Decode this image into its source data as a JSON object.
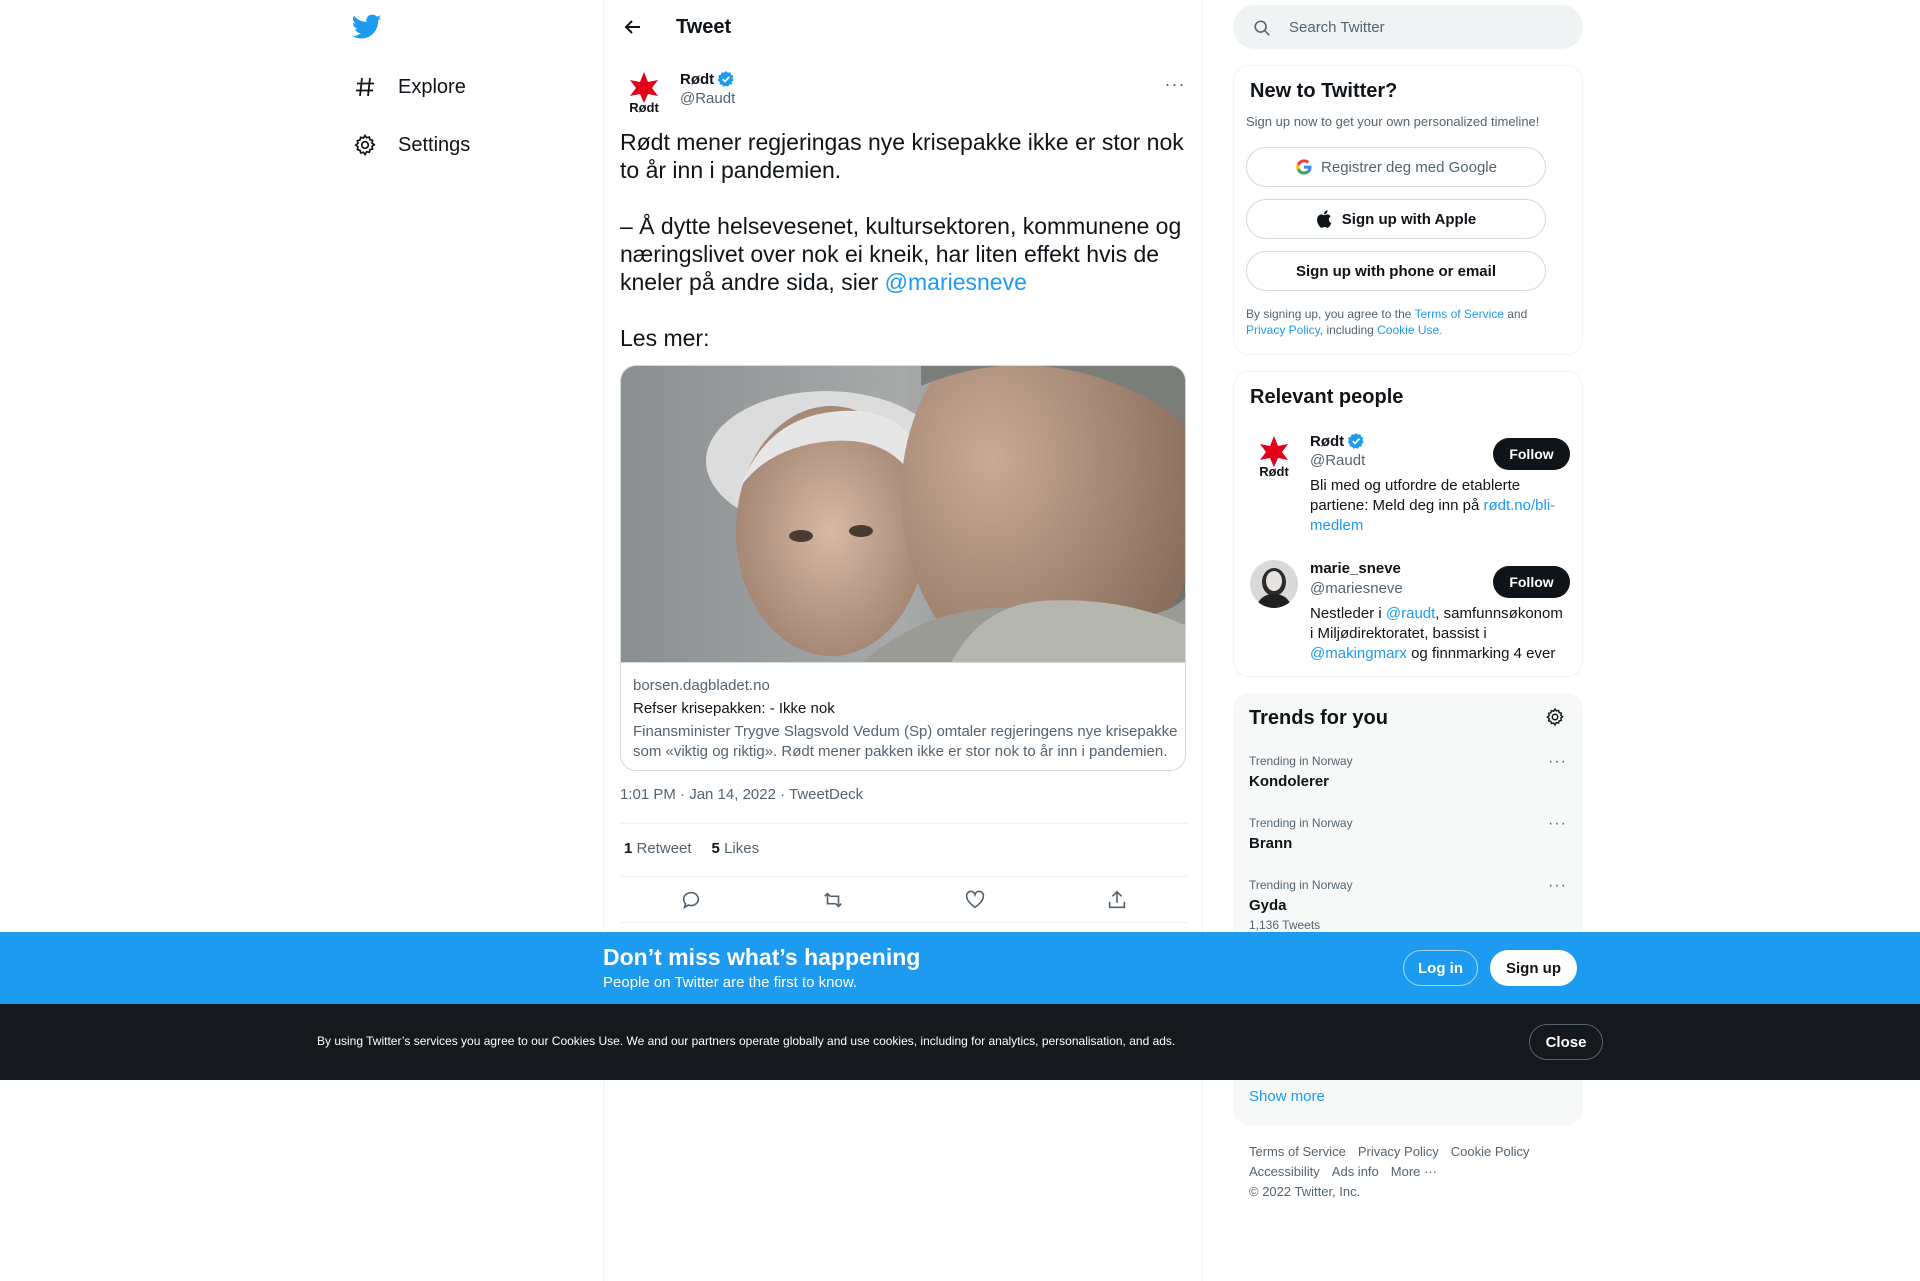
{
  "nav": {
    "items": [
      {
        "label": "Explore",
        "icon": "hashtag-icon"
      },
      {
        "label": "Settings",
        "icon": "gear-icon"
      }
    ]
  },
  "header": {
    "title": "Tweet"
  },
  "tweet": {
    "author_name": "Rødt",
    "author_handle": "@Raudt",
    "avatar_text": "Rødt",
    "text_part1": "Rødt mener regjeringas nye krisepakke ikke er stor nok to år inn i pandemien.\n\n– Å dytte helsevesenet, kultursektoren, kommunene og næringslivet over nok ei kneik, har liten effekt hvis de kneler på andre sida, sier ",
    "mention": "@mariesneve",
    "text_part2": "\n\nLes mer:",
    "card": {
      "domain": "borsen.dagbladet.no",
      "title": "Refser krisepakken: - Ikke nok",
      "description": "Finansminister Trygve Slagsvold Vedum (Sp) omtaler regjeringens nye krisepakke som «viktig og riktig». Rødt mener pakken ikke er stor nok to år inn i pandemien."
    },
    "timestamp": "1:01 PM · Jan 14, 2022 · TweetDeck",
    "retweet_count": "1",
    "retweet_label": "Retweet",
    "like_count": "5",
    "like_label": "Likes"
  },
  "search": {
    "placeholder": "Search Twitter"
  },
  "new_to_twitter": {
    "title": "New to Twitter?",
    "subtitle": "Sign up now to get your own personalized timeline!",
    "google_label": "Registrer deg med Google",
    "apple_label": "Sign up with Apple",
    "phone_label": "Sign up with phone or email",
    "legal_prefix": "By signing up, you agree to the ",
    "terms": "Terms of Service",
    "and": " and ",
    "privacy": "Privacy Policy",
    "including": ", including ",
    "cookie": "Cookie Use."
  },
  "relevant_people": {
    "title": "Relevant people",
    "people": [
      {
        "name": "Rødt",
        "handle": "@Raudt",
        "bio_text": "Bli med og utfordre de etablerte partiene: Meld deg inn på ",
        "bio_link": "rødt.no/bli-medlem",
        "follow_label": "Follow"
      },
      {
        "name": "marie_sneve",
        "handle": "@mariesneve",
        "bio_a": "Nestleder i ",
        "bio_link1": "@raudt",
        "bio_b": ", samfunnsøkonom i Miljødirektoratet, bassist i ",
        "bio_link2": "@makingmarx",
        "bio_c": " og finnmarking 4 ever",
        "follow_label": "Follow"
      }
    ]
  },
  "trends": {
    "title": "Trends for you",
    "items": [
      {
        "context": "Trending in Norway",
        "name": "Kondolerer",
        "count": ""
      },
      {
        "context": "Trending in Norway",
        "name": "Brann",
        "count": ""
      },
      {
        "context": "Trending in Norway",
        "name": "Gyda",
        "count": "1,136 Tweets"
      }
    ],
    "show_more": "Show more"
  },
  "footer": {
    "row1": [
      "Terms of Service",
      "Privacy Policy",
      "Cookie Policy"
    ],
    "row2": [
      "Accessibility",
      "Ads info",
      "More ···"
    ],
    "copyright": "© 2022 Twitter, Inc."
  },
  "bottom_bar": {
    "title": "Don’t miss what’s happening",
    "subtitle": "People on Twitter are the first to know.",
    "login": "Log in",
    "signup": "Sign up"
  },
  "cookie_bar": {
    "text": "By using Twitter’s services you agree to our Cookies Use. We and our partners operate globally and use cookies, including for analytics, personalisation, and ads.",
    "close": "Close"
  },
  "colors": {
    "accent": "#1d9bf0",
    "text": "#0f1419",
    "muted": "#536471",
    "rodt_red": "#e3001b"
  }
}
